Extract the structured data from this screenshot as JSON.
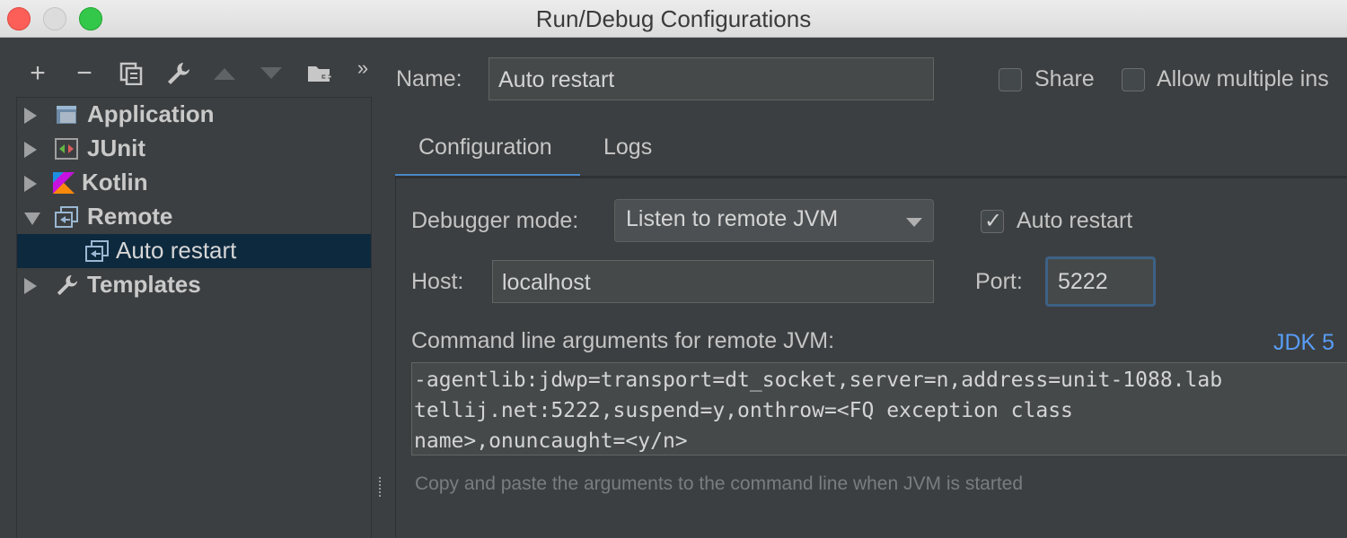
{
  "window": {
    "title": "Run/Debug Configurations"
  },
  "toolbar": {
    "add": "+",
    "remove": "−",
    "more": "»"
  },
  "tree": {
    "items": [
      {
        "label": "Application",
        "icon": "application-icon",
        "expanded": false
      },
      {
        "label": "JUnit",
        "icon": "junit-icon",
        "expanded": false
      },
      {
        "label": "Kotlin",
        "icon": "kotlin-icon",
        "expanded": false
      },
      {
        "label": "Remote",
        "icon": "remote-icon",
        "expanded": true
      },
      {
        "label": "Auto restart",
        "icon": "remote-config-icon",
        "selected": true
      },
      {
        "label": "Templates",
        "icon": "wrench-icon",
        "expanded": false
      }
    ]
  },
  "form": {
    "name_label": "Name:",
    "name_value": "Auto restart",
    "share_label": "Share",
    "share_checked": false,
    "allow_multiple_label": "Allow multiple ins",
    "allow_multiple_checked": false
  },
  "tabs": [
    {
      "label": "Configuration",
      "active": true
    },
    {
      "label": "Logs",
      "active": false
    }
  ],
  "config": {
    "debugger_mode_label": "Debugger mode:",
    "debugger_mode_value": "Listen to remote JVM",
    "auto_restart_label": "Auto restart",
    "auto_restart_checked": true,
    "host_label": "Host:",
    "host_value": "localhost",
    "port_label": "Port:",
    "port_value": "5222",
    "cmd_label": "Command line arguments for remote JVM:",
    "jdk_link": "JDK 5",
    "cmd_lines": [
      "-agentlib:jdwp=transport=dt_socket,server=n,address=unit-1088.lab",
      "tellij.net:5222,suspend=y,onthrow=<FQ exception class",
      "name>,onuncaught=<y/n>"
    ],
    "hint": "Copy and paste the arguments to the command line when JVM is started"
  },
  "colors": {
    "accent": "#4a88c7",
    "link": "#589df6",
    "selection": "#0d293e",
    "background": "#3c3f41"
  }
}
